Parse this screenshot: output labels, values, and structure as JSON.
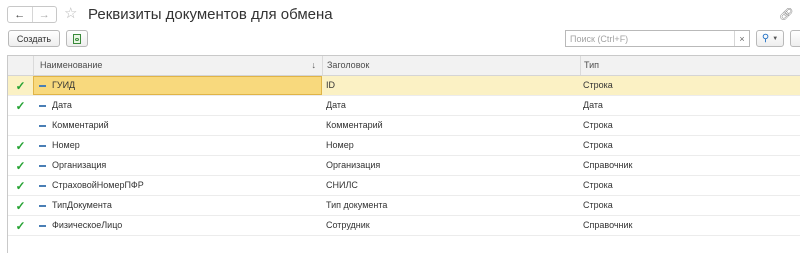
{
  "window": {
    "title": "Реквизиты документов для обмена",
    "nav_back_icon": "arrow-left",
    "nav_forward_icon": "arrow-right",
    "favorite_icon": "star",
    "link_icon": "link"
  },
  "toolbar": {
    "create_label": "Создать",
    "copy_icon": "copy-document-icon",
    "search_placeholder": "Поиск (Ctrl+F)",
    "search_value": "",
    "clear_label": "×",
    "find_icon": "magnifier",
    "dropdown_icon": "chevron-down"
  },
  "table": {
    "columns": [
      "Наименование",
      "Заголовок",
      "Тип"
    ],
    "sort_indicator": "↓",
    "check_glyph": "✓",
    "rows": [
      {
        "checked": true,
        "selected": true,
        "name": "ГУИД",
        "header": "ID",
        "type": "Строка"
      },
      {
        "checked": true,
        "selected": false,
        "name": "Дата",
        "header": "Дата",
        "type": "Дата"
      },
      {
        "checked": false,
        "selected": false,
        "name": "Комментарий",
        "header": "Комментарий",
        "type": "Строка"
      },
      {
        "checked": true,
        "selected": false,
        "name": "Номер",
        "header": "Номер",
        "type": "Строка"
      },
      {
        "checked": true,
        "selected": false,
        "name": "Организация",
        "header": "Организация",
        "type": "Справочник"
      },
      {
        "checked": true,
        "selected": false,
        "name": "СтраховойНомерПФР",
        "header": "СНИЛС",
        "type": "Строка"
      },
      {
        "checked": true,
        "selected": false,
        "name": "ТипДокумента",
        "header": "Тип документа",
        "type": "Строка"
      },
      {
        "checked": true,
        "selected": false,
        "name": "ФизическоеЛицо",
        "header": "Сотрудник",
        "type": "Справочник"
      }
    ]
  },
  "colors": {
    "check": "#27a334",
    "selected_row": "#fbf1c4",
    "selected_cell": "#f8d97d",
    "attribute_marker": "#4a7fb5",
    "search_button_icon": "#1e6fc4"
  }
}
